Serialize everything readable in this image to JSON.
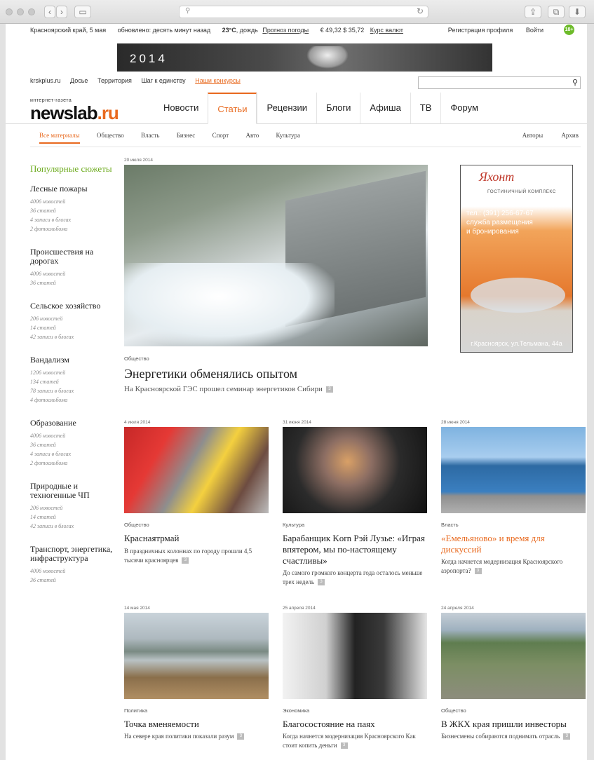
{
  "top_bar": {
    "region": "Красноярский край, 5 мая",
    "updated": "обновлено: десять минут назад",
    "weather_temp": "23°C",
    "weather_desc": ", дождь",
    "forecast_link": "Прогноз погоды",
    "rates": "€ 49,32 $ 35,72",
    "rates_link": "Курс валют",
    "register": "Регистрация профиля",
    "login": "Войти",
    "age_badge": "18+"
  },
  "banner": {
    "year": "2014"
  },
  "links": [
    "krskplus.ru",
    "Досье",
    "Территория",
    "Шаг к единству",
    "Наши конкурсы"
  ],
  "logo": {
    "small": "интернет-газета",
    "name": "newslab",
    "dot": ".ru"
  },
  "nav": [
    "Новости",
    "Статьи",
    "Рецензии",
    "Блоги",
    "Афиша",
    "ТВ",
    "Форум"
  ],
  "subnav": [
    "Все материалы",
    "Общество",
    "Власть",
    "Бизнес",
    "Спорт",
    "Авто",
    "Культура"
  ],
  "subnav_right": [
    "Авторы",
    "Архив"
  ],
  "sidebar": {
    "title": "Популярные сюжеты",
    "items": [
      {
        "title": "Лесные пожары",
        "meta": [
          "4006 новостей",
          "36 статей",
          "4 записи в блогах",
          "2 фотоальбома"
        ]
      },
      {
        "title": "Происшествия на дорогах",
        "meta": [
          "4006 новостей",
          "36 статей"
        ]
      },
      {
        "title": "Сельское хозяйство",
        "meta": [
          "206 новостей",
          "14 статей",
          "42 записи в блогах"
        ]
      },
      {
        "title": "Вандализм",
        "meta": [
          "1206 новостей",
          "134 статей",
          "78 записи в блогах",
          "4 фотоальбома"
        ]
      },
      {
        "title": "Образование",
        "meta": [
          "4006 новостей",
          "36 статей",
          "4 записи в блогах",
          "2 фотоальбома"
        ]
      },
      {
        "title": "Природные и техногенные ЧП",
        "meta": [
          "206 новостей",
          "14 статей",
          "42 записи в блогах"
        ]
      },
      {
        "title": "Транспорт, энергетика, инфраструктура",
        "meta": [
          "4006 новостей",
          "36 статей"
        ]
      }
    ]
  },
  "main": {
    "date": "20 июля 2014",
    "category": "Общество",
    "title": "Энергетики обменялись опытом",
    "lead": "На Красноярской ГЭС прошел семинар энергетиков Сибири",
    "comments": "3"
  },
  "ad": {
    "brand": "Яхонт",
    "sub": "ГОСТИНИЧНЫЙ КОМПЛЕКС",
    "phone": "тел.: (391) 256-67-67",
    "line1": "служба размещения",
    "line2": "и бронирования",
    "address": "г.Красноярск, ул.Тельмана, 44а"
  },
  "cards": [
    {
      "date": "4 июля 2014",
      "category": "Общество",
      "title": "Краснаятрмай",
      "lead": "В праздничных колоннах по городу прошли 4,5 тысячи красноярцев",
      "comments": "3"
    },
    {
      "date": "31 июня 2014",
      "category": "Культура",
      "title": "Барабанщик Korn Рэй Лузье: «Играя впятером, мы по-настоящему счастливы»",
      "lead": "До самого громкого концерта года осталось меньше трех недель",
      "comments": "3"
    },
    {
      "date": "28 июня 2014",
      "category": "Власть",
      "title": "«Емельяново» и время для дискуссий",
      "lead": "Когда начнется модернизация Красноярского аэропорта?",
      "comments": "3"
    },
    {
      "date": "14 мая 2014",
      "category": "Политика",
      "title": "Точка вменяемости",
      "lead": "На севере края политики показали разум",
      "comments": "3"
    },
    {
      "date": "25 апреля 2014",
      "category": "Экономика",
      "title": "Благосостояние на паях",
      "lead": "Когда начнется модернизация Красноярского Как стоит копить деньги",
      "comments": "3"
    },
    {
      "date": "24 апреля 2014",
      "category": "Общество",
      "title": "В ЖКХ края пришли инвесторы",
      "lead": "Бизнесмены собираются поднимать отрасль",
      "comments": "3"
    }
  ]
}
